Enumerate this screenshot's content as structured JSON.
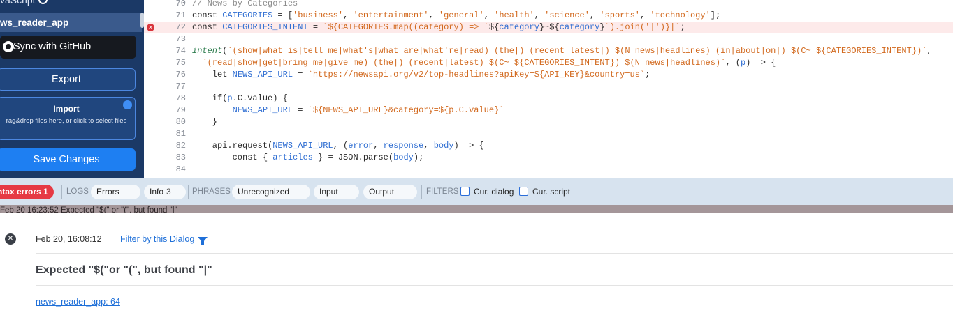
{
  "sidebar": {
    "top_label": "vaScript",
    "project_name": "ws_reader_app",
    "github_label": "Sync with GitHub",
    "export_label": "Export",
    "import_title": "Import",
    "import_hint": "rag&drop files here, or click to select files",
    "save_label": "Save Changes"
  },
  "editor": {
    "lines": [
      {
        "n": "70",
        "code": "// News by Categories"
      },
      {
        "n": "71",
        "code": "const CATEGORIES = ['business', 'entertainment', 'general', 'health', 'science', 'sports', 'technology'];"
      },
      {
        "n": "72",
        "code": "const CATEGORIES_INTENT = `${CATEGORIES.map((category) => `${category}~${category}`).join('|')}|`;",
        "error": true
      },
      {
        "n": "73",
        "code": ""
      },
      {
        "n": "74",
        "code": "intent(`(show|what is|tell me|what's|what are|what're|read) (the|) (recent|latest|) $(N news|headlines) (in|about|on|) $(C~ ${CATEGORIES_INTENT})`,"
      },
      {
        "n": "75",
        "code": "  `(read|show|get|bring me|give me) (the|) (recent|latest) $(C~ ${CATEGORIES_INTENT}) $(N news|headlines)`, (p) => {"
      },
      {
        "n": "76",
        "code": "    let NEWS_API_URL = `https://newsapi.org/v2/top-headlines?apiKey=${API_KEY}&country=us`;"
      },
      {
        "n": "77",
        "code": ""
      },
      {
        "n": "78",
        "code": "    if(p.C.value) {"
      },
      {
        "n": "79",
        "code": "        NEWS_API_URL = `${NEWS_API_URL}&category=${p.C.value}`"
      },
      {
        "n": "80",
        "code": "    }"
      },
      {
        "n": "81",
        "code": ""
      },
      {
        "n": "82",
        "code": "    api.request(NEWS_API_URL, (error, response, body) => {"
      },
      {
        "n": "83",
        "code": "        const { articles } = JSON.parse(body);"
      },
      {
        "n": "84",
        "code": ""
      }
    ]
  },
  "toolbar": {
    "syntax_errors_label": "ntax errors",
    "syntax_errors_count": "1",
    "logs_label": "LOGS",
    "errors_label": "Errors",
    "info_label": "Info",
    "info_count": "3",
    "phrases_label": "PHRASES",
    "unrecognized_label": "Unrecognized",
    "input_label": "Input",
    "output_label": "Output",
    "filters_label": "FILTERS",
    "cur_dialog_label": "Cur. dialog",
    "cur_script_label": "Cur. script"
  },
  "strip": {
    "text": "Feb 20  16:23:52   Expected \"$(\" or \"(\", but found \"|\""
  },
  "error_detail": {
    "timestamp": "Feb 20, 16:08:12",
    "filter_label": "Filter by this Dialog",
    "message": "Expected \"$(\"or \"(\", but found \"|\"",
    "location_link": "news_reader_app: 64"
  },
  "colors": {
    "sidebar_bg": "#1b3966",
    "save_button": "#1e7ff2",
    "error_red": "#e63a44",
    "link_blue": "#1e6fd8"
  }
}
